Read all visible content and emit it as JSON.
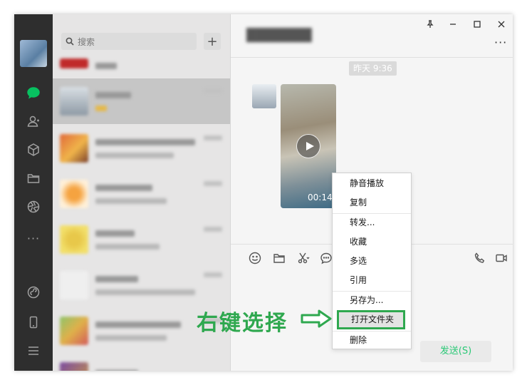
{
  "sidebar": {
    "search_placeholder": "搜索",
    "add_icon": "plus-icon",
    "nav_icons": [
      "chat-icon",
      "contacts-icon",
      "favorites-icon",
      "folder-icon",
      "moments-icon",
      "more-icon",
      "miniprogram-icon",
      "phone-icon",
      "menu-icon"
    ]
  },
  "chat": {
    "timestamp": "昨天 9:36",
    "video_duration": "00:14",
    "send_label": "发送(S)"
  },
  "context_menu": {
    "items": [
      "静音播放",
      "复制",
      "转发...",
      "收藏",
      "多选",
      "引用",
      "另存为...",
      "打开文件夹",
      "删除"
    ]
  },
  "annotation": {
    "text": "右键选择",
    "color": "#2fa84f"
  },
  "colors": {
    "accent": "#07c160",
    "nav_bg": "#2e2e2e",
    "list_bg": "#e6e5e5",
    "chat_bg": "#f5f5f5"
  }
}
